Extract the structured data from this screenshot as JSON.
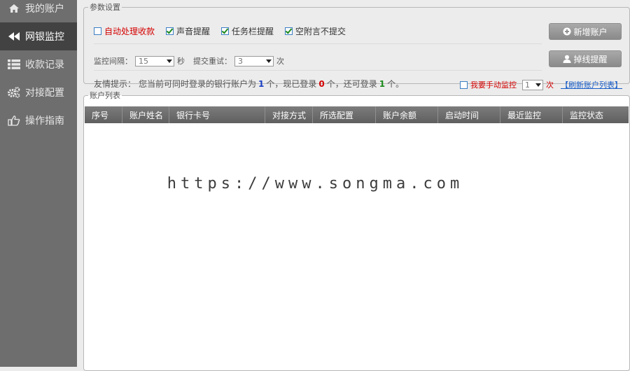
{
  "sidebar": {
    "items": [
      {
        "label": "我的账户",
        "icon": "home-icon"
      },
      {
        "label": "网银监控",
        "icon": "rewind-icon",
        "active": true
      },
      {
        "label": "收款记录",
        "icon": "list-icon"
      },
      {
        "label": "对接配置",
        "icon": "gears-icon"
      },
      {
        "label": "操作指南",
        "icon": "pointing-hand-icon"
      }
    ]
  },
  "params": {
    "legend": "参数设置",
    "options": [
      {
        "label": "自动处理收款",
        "checked": false
      },
      {
        "label": "声音提醒",
        "checked": true
      },
      {
        "label": "任务栏提醒",
        "checked": true
      },
      {
        "label": "空附言不提交",
        "checked": true
      }
    ],
    "interval_label": "监控间隔：",
    "interval_value": "15",
    "interval_unit": "秒",
    "retry_label": "提交重试：",
    "retry_value": "3",
    "retry_unit": "次",
    "tip_prefix": "友情提示：",
    "tip_text_1": "您当前可同时登录的银行账户为",
    "tip_total": "1",
    "tip_text_2": "个，现已登录",
    "tip_logged": "0",
    "tip_text_3": "个，还可登录",
    "tip_remain": "1",
    "tip_text_4": "个。",
    "manual_label": "我要手动监控",
    "manual_value": "1",
    "manual_unit": "次",
    "refresh_link": "【刷新账户列表】",
    "add_account_button": "新增账户",
    "offline_alert_button": "掉线提醒"
  },
  "accounts": {
    "legend": "账户列表",
    "columns": [
      "序号",
      "账户姓名",
      "银行卡号",
      "对接方式",
      "所选配置",
      "账户余额",
      "启动时间",
      "最近监控",
      "监控状态"
    ],
    "rows": []
  },
  "watermark": "https://www.songma.com",
  "colors": {
    "sidebar_bg": "#6e6e6e",
    "sidebar_active_bg": "#424242",
    "table_header_bg": "#6a6a6a",
    "highlight_red": "#d40000",
    "highlight_blue": "#1a3ec4",
    "highlight_green": "#1a8a1a"
  }
}
